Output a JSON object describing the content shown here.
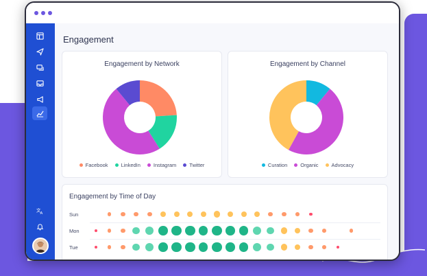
{
  "page": {
    "title": "Engagement"
  },
  "colors": {
    "accent": "#6c57e0",
    "sidebar": "#1f4fd3",
    "facebook": "#ff8a65",
    "linkedin": "#20d4a0",
    "instagram": "#c94bd6",
    "twitter": "#5a4bd1",
    "curation": "#12b9e0",
    "organic": "#c94bd6",
    "advocacy": "#ffc35c"
  },
  "sidebar": {
    "icons": [
      "layout-icon",
      "send-icon",
      "chat-icon",
      "inbox-icon",
      "megaphone-icon",
      "analytics-icon",
      "translate-icon",
      "bell-icon"
    ],
    "active": "analytics-icon"
  },
  "network_card": {
    "title": "Engagement by Network",
    "legend": [
      "Facebook",
      "LinkedIn",
      "Instagram",
      "Twitter"
    ]
  },
  "channel_card": {
    "title": "Engagement by Channel",
    "legend": [
      "Curation",
      "Organic",
      "Advocacy"
    ]
  },
  "time_card": {
    "title": "Engagement by Time of Day",
    "rows": [
      "Sun",
      "Mon",
      "Tue"
    ]
  },
  "chart_data": [
    {
      "type": "pie",
      "title": "Engagement by Network",
      "categories": [
        "Facebook",
        "LinkedIn",
        "Instagram",
        "Twitter"
      ],
      "values": [
        24,
        17,
        48,
        11
      ]
    },
    {
      "type": "pie",
      "title": "Engagement by Channel",
      "categories": [
        "Curation",
        "Organic",
        "Advocacy"
      ],
      "values": [
        11,
        47,
        42
      ]
    },
    {
      "type": "heatmap",
      "title": "Engagement by Time of Day",
      "rows": [
        "Sun",
        "Mon",
        "Tue"
      ],
      "note_values": "relative bubble intensity per hour slot (0-1)",
      "values": [
        [
          0,
          0.2,
          0.3,
          0.3,
          0.3,
          0.4,
          0.4,
          0.4,
          0.4,
          0.5,
          0.4,
          0.4,
          0.4,
          0.3,
          0.3,
          0.2,
          0.1,
          0,
          0,
          0
        ],
        [
          0.1,
          0.2,
          0.3,
          0.6,
          0.7,
          0.8,
          0.9,
          0.9,
          0.8,
          0.9,
          0.8,
          0.8,
          0.7,
          0.6,
          0.5,
          0.4,
          0.3,
          0.2,
          0,
          0.2
        ],
        [
          0.1,
          0.2,
          0.3,
          0.6,
          0.7,
          0.8,
          0.9,
          0.9,
          0.8,
          0.9,
          0.8,
          0.8,
          0.7,
          0.6,
          0.5,
          0.4,
          0.3,
          0.2,
          0.1,
          0
        ]
      ]
    }
  ]
}
